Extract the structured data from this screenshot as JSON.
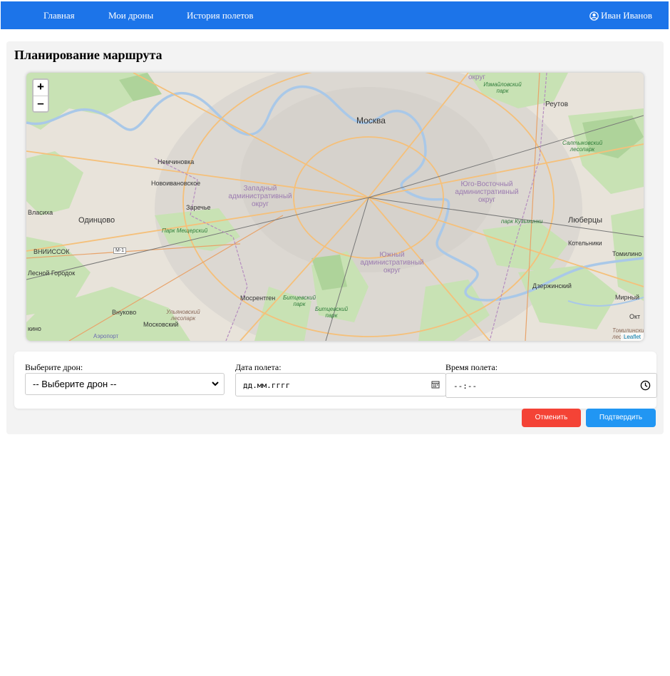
{
  "nav": {
    "links": [
      "Главная",
      "Мои дроны",
      "История полетов"
    ],
    "user_name": "Иван Иванов",
    "color": "#1c74e9"
  },
  "page": {
    "title": "Планирование маршрута"
  },
  "map": {
    "zoom_in": "+",
    "zoom_out": "–",
    "attribution": "Leaflet",
    "labels": {
      "moscow": "Москва",
      "reutov": "Реутов",
      "lyubertsy": "Люберцы",
      "odintsovo": "Одинцово",
      "vlasikha": "Власиха",
      "vniissok": "ВНИИССОК",
      "lesnoy": "Лесной Городок",
      "nemchinovka": "Немчиновка",
      "novoivanovskoe": "Новоивановское",
      "zarechye": "Заречье",
      "mosrentgen": "Мосрентген",
      "vnukovo": "Внуково",
      "moskovsky": "Московский",
      "kotelniki": "Котельники",
      "dzerzhinsky": "Дзержинский",
      "tomilino": "Томилино",
      "mirny": "Мирный",
      "okt": "Окт",
      "kino": "кино",
      "airport": "Аэропорт",
      "west_district": "Западный административный округ",
      "southeast_district": "Юго-Восточный административный округ",
      "south_district": "Южный административный округ",
      "okrug_top": "округ",
      "izmailovo": "Измайловский парк",
      "saltykovsky": "Салтыковский лесопарк",
      "kuzminki": "парк Кузьминки",
      "meshchersky": "Парк Мещерский",
      "bitsevsky1": "Битцевский парк",
      "bitsevsky2": "Битцевский парк",
      "ulyanovsky": "Ульяновский лесопарк",
      "tomilinsky": "Томилинский лесопа",
      "m1": "М-1"
    }
  },
  "form": {
    "drone_label": "Выберите дрон:",
    "drone_value": "-- Выберите дрон --",
    "date_label": "Дата полета:",
    "date_value": "дд.мм.гггг",
    "time_label": "Время полета:",
    "time_value": "--:--"
  },
  "actions": {
    "cancel": "Отменить",
    "confirm": "Подтвердить",
    "cancel_color": "#f44336",
    "confirm_color": "#2196f3"
  }
}
